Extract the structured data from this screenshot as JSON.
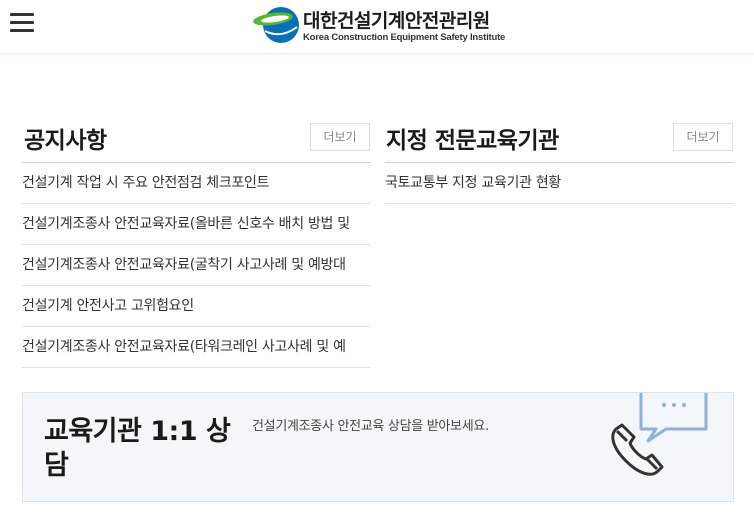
{
  "header": {
    "menu_icon": "hamburger-menu-icon",
    "logo_korean": "대한건설기계안전관리원",
    "logo_english": "Korea Construction Equipment Safety Institute"
  },
  "notice": {
    "title": "공지사항",
    "more_label": "더보기",
    "items": [
      "건설기계 작업 시 주요 안전점검 체크포인트",
      "건설기계조종사 안전교육자료(올바른 신호수 배치 방법 및",
      "건설기계조종사 안전교육자료(굴착기 사고사례 및 예방대",
      "건설기계 안전사고 고위험요인",
      "건설기계조종사 안전교육자료(타워크레인 사고사례 및 예"
    ]
  },
  "institutions": {
    "title": "지정 전문교육기관",
    "more_label": "더보기",
    "items": [
      "국토교통부 지정 교육기관 현황"
    ]
  },
  "consult": {
    "title": "교육기관 1:1 상담",
    "description": "건설기계조종사 안전교육 상담을 받아보세요.",
    "icon": "phone-chat-icon"
  },
  "colors": {
    "logo_blue": "#0b6fb6",
    "logo_green": "#5cb531",
    "consult_bg": "#f3f7fb",
    "icon_blue": "#8fb2d6"
  }
}
